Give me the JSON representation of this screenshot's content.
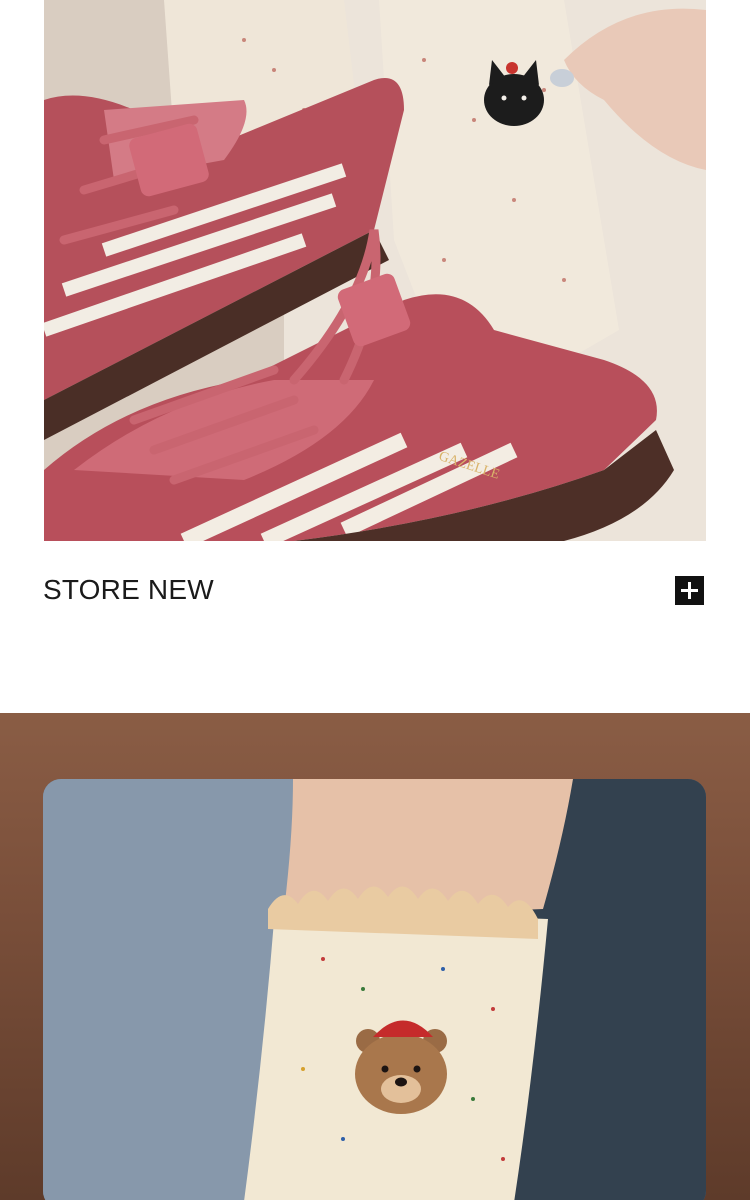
{
  "store": {
    "title": "STORE NEW",
    "expand_icon": "plus-icon"
  },
  "images": {
    "top_photo": "sneakers-with-cat-socks-photo",
    "bottom_photo": "bear-embroidered-ruffle-sock-photo"
  },
  "colors": {
    "background": "#ffffff",
    "text": "#1a1a1a",
    "button": "#111111",
    "bottom_backdrop": "#7a4f3a"
  }
}
